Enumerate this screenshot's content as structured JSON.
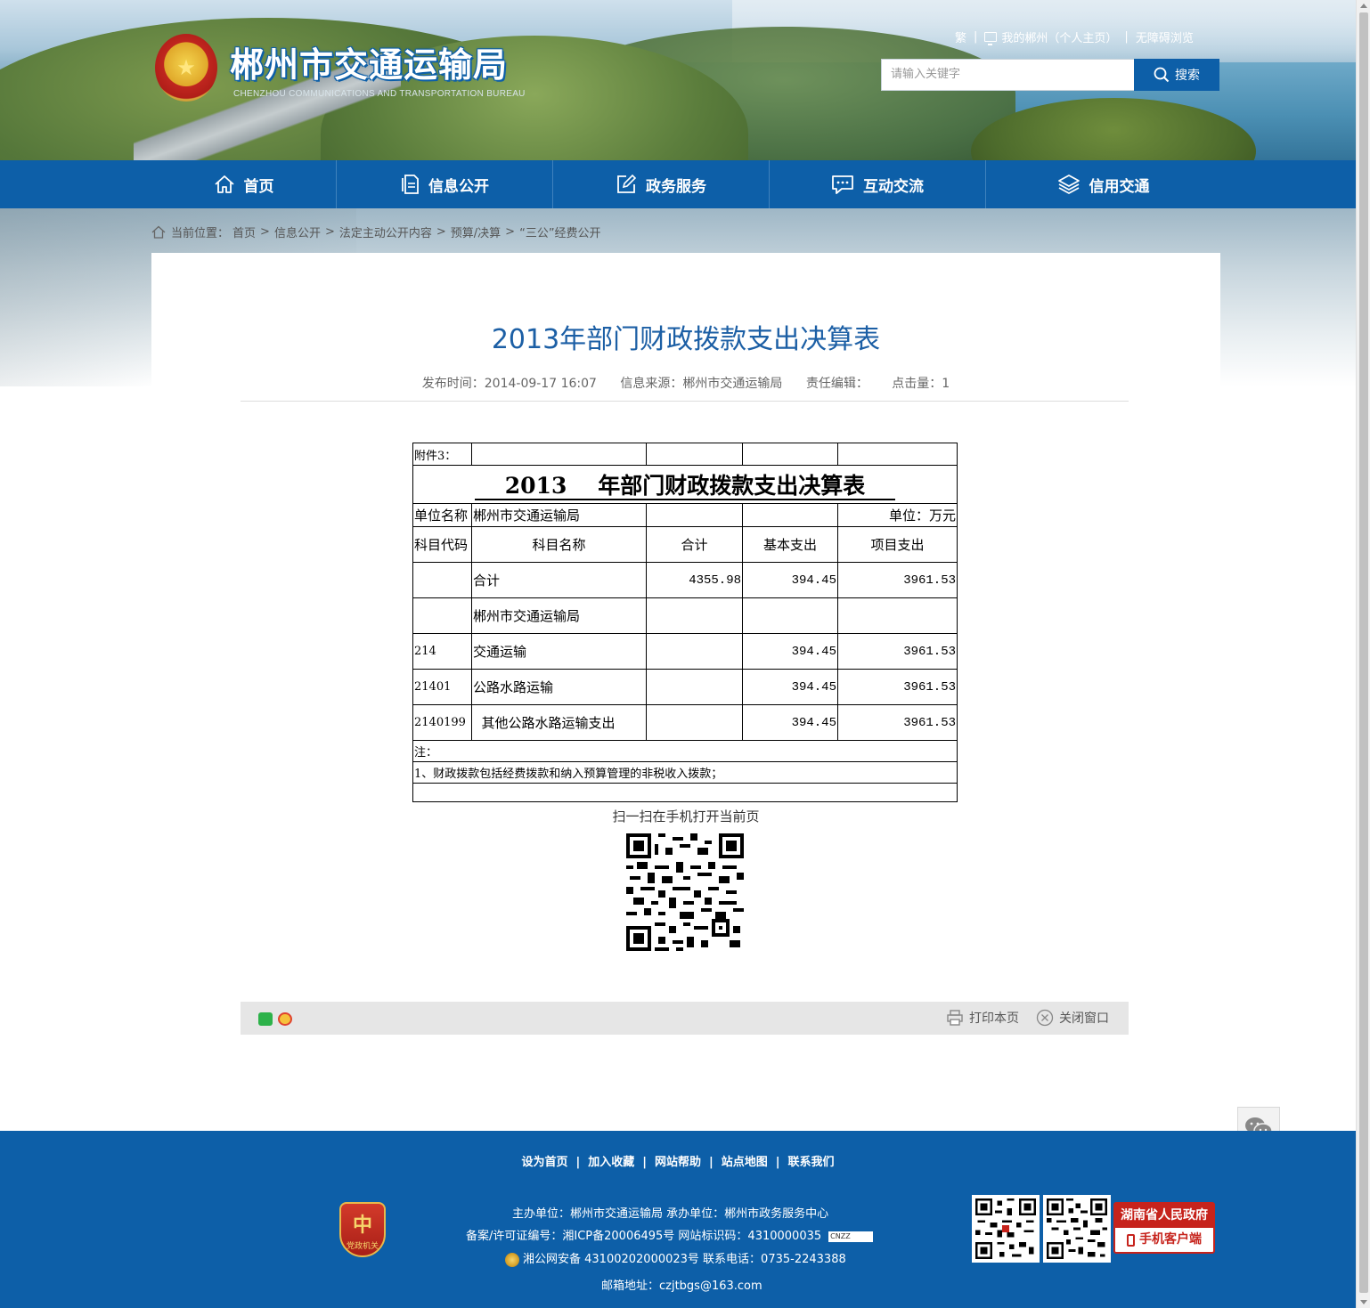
{
  "header": {
    "site_title": "郴州市交通运输局",
    "site_subtitle": "CHENZHOU COMMUNICATIONS AND TRANSPORTATION BUREAU",
    "emblem_glyph": "★",
    "top_links": {
      "traditional": "繁",
      "my_chenzhou": "我的郴州（个人主页）",
      "accessible": "无障碍浏览"
    },
    "search": {
      "placeholder": "请输入关键字",
      "button_label": "搜索"
    }
  },
  "nav": {
    "items": [
      {
        "label": "首页",
        "icon": "home-icon"
      },
      {
        "label": "信息公开",
        "icon": "document-icon"
      },
      {
        "label": "政务服务",
        "icon": "edit-icon"
      },
      {
        "label": "互动交流",
        "icon": "chat-icon"
      },
      {
        "label": "信用交通",
        "icon": "layers-icon"
      }
    ]
  },
  "breadcrumb": {
    "prefix": "当前位置：",
    "items": [
      "首页",
      "信息公开",
      "法定主动公开内容",
      "预算/决算",
      "“三公”经费公开"
    ],
    "separator": ">"
  },
  "article": {
    "title": "2013年部门财政拨款支出决算表",
    "meta": {
      "publish_time": "发布时间：2014-09-17 16:07",
      "source": "信息来源：郴州市交通运输局",
      "editor": "责任编辑：",
      "clicks": "点击量：1"
    }
  },
  "table": {
    "attachment": "附件3：",
    "title_year": "2013",
    "title_rest": "年部门财政拨款支出决算表",
    "unit_name_label": "单位名称",
    "unit_name_value": "郴州市交通运输局",
    "unit_label": "单位：万元",
    "headers": [
      "科目代码",
      "科目名称",
      "合计",
      "基本支出",
      "项目支出"
    ],
    "rows": [
      {
        "code": "",
        "name": "合计",
        "total": "4355.98",
        "basic": "394.45",
        "project": "3961.53"
      },
      {
        "code": "",
        "name": "郴州市交通运输局",
        "total": "",
        "basic": "",
        "project": ""
      },
      {
        "code": "214",
        "name": "交通运输",
        "total": "",
        "basic": "394.45",
        "project": "3961.53"
      },
      {
        "code": "21401",
        "name": "公路水路运输",
        "total": "",
        "basic": "394.45",
        "project": "3961.53"
      },
      {
        "code": "2140199",
        "name": "  其他公路水路运输支出",
        "total": "",
        "basic": "394.45",
        "project": "3961.53"
      }
    ],
    "note_label": "注：",
    "note_1": "1、财政拨款包括经费拨款和纳入预算管理的非税收入拨款；"
  },
  "qr": {
    "caption": "扫一扫在手机打开当前页"
  },
  "toolbar": {
    "print_label": "打印本页",
    "close_label": "关闭窗口"
  },
  "footer": {
    "links": [
      "设为首页",
      "加入收藏",
      "网站帮助",
      "站点地图",
      "联系我们"
    ],
    "link_separator": "|",
    "sponsor": "主办单位：郴州市交通运输局   承办单位：郴州市政务服务中心",
    "icp": "备案/许可证编号：湘ICP备20006495号   网站标识码：4310000035",
    "police": "湘公网安备 43100202000023号   联系电话：0735-2243388",
    "email": "邮箱地址：czjtbgs@163.com",
    "party_badge_glyph": "中",
    "party_badge_text": "党政机关",
    "cnzz_label": "CNZZ",
    "gov_app_top": "湖南省人民政府",
    "gov_app_bottom": "手机客户端"
  },
  "colors": {
    "primary_blue": "#0d5fa8",
    "title_blue": "#1c5fa5",
    "gov_red": "#c6231c"
  }
}
